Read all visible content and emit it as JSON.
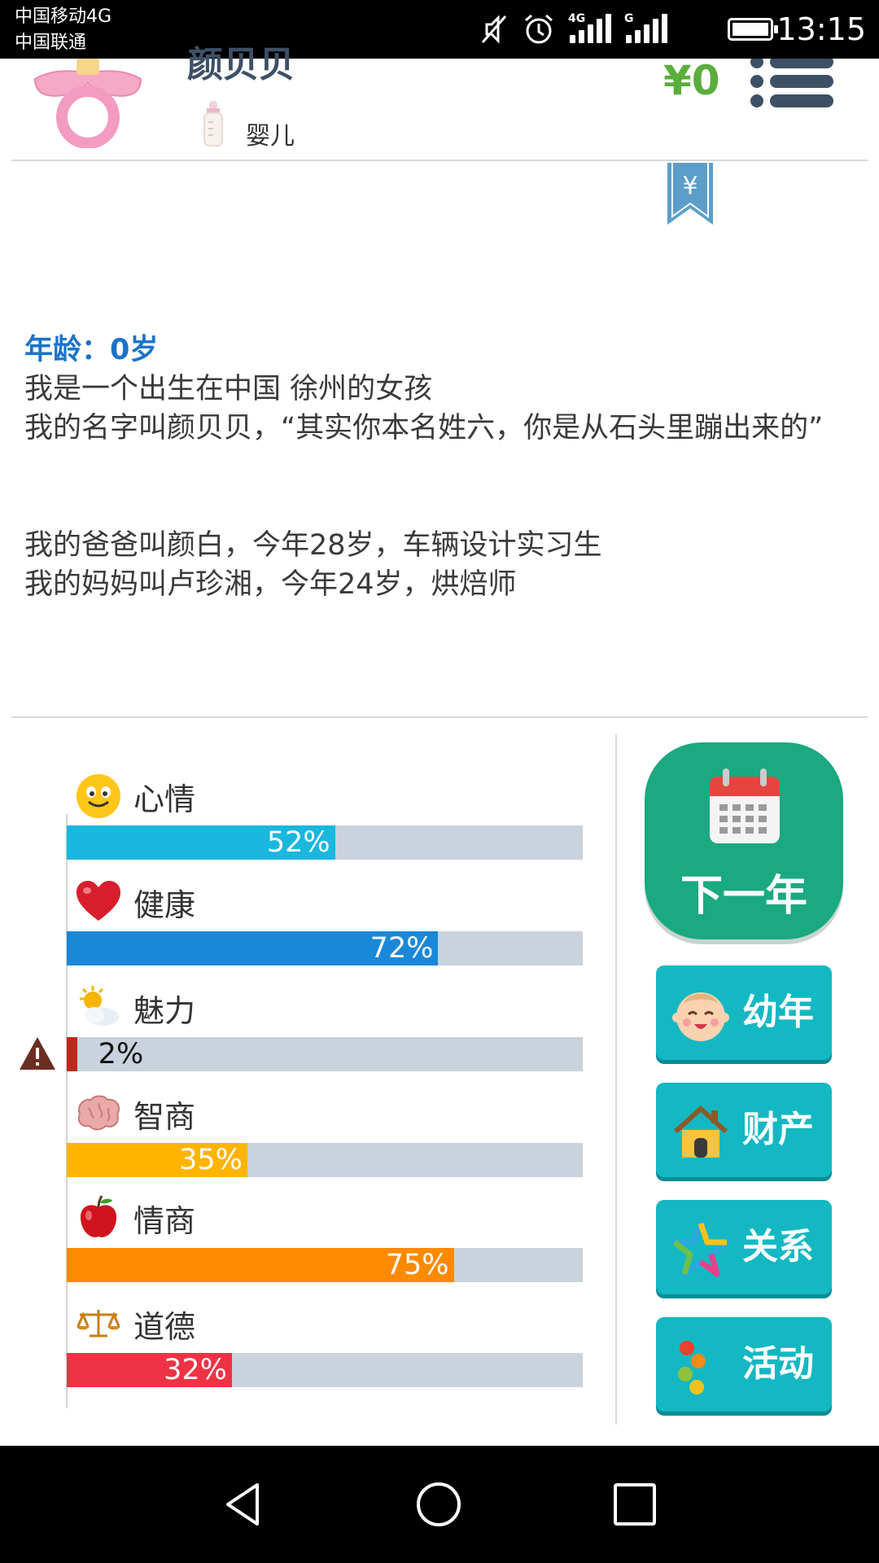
{
  "status_bar": {
    "carrier1": "中国移动4G",
    "carrier2": "中国联通",
    "sig1_tag": "4G",
    "sig2_tag": "G",
    "time": "13:15"
  },
  "header": {
    "name": "颜贝贝",
    "stage": "婴儿",
    "money": "¥0"
  },
  "story": {
    "age": "年龄：0岁",
    "line1": "我是一个出生在中国 徐州的女孩",
    "line2": "我的名字叫颜贝贝，“其实你本名姓六，你是从石头里蹦出来的”",
    "line3": "我的爸爸叫颜白，今年28岁，车辆设计实习生",
    "line4": "我的妈妈叫卢珍湘，今年24岁，烘焙师"
  },
  "stats": [
    {
      "label": "心情",
      "value": 52,
      "display": "52%",
      "color": "#1ab7de",
      "icon": "smiley-icon"
    },
    {
      "label": "健康",
      "value": 72,
      "display": "72%",
      "color": "#1a88d8",
      "icon": "heart-icon"
    },
    {
      "label": "魅力",
      "value": 2,
      "display": "2%",
      "color": "#c0281c",
      "icon": "sun-cloud-icon"
    },
    {
      "label": "智商",
      "value": 35,
      "display": "35%",
      "color": "#ffb400",
      "icon": "brain-icon"
    },
    {
      "label": "情商",
      "value": 75,
      "display": "75%",
      "color": "#ff8a00",
      "icon": "apple-icon"
    },
    {
      "label": "道德",
      "value": 32,
      "display": "32%",
      "color": "#ee3344",
      "icon": "scales-icon"
    }
  ],
  "actions": {
    "next_year": "下一年",
    "childhood": "幼年",
    "property": "财产",
    "relations": "关系",
    "activities": "活动"
  },
  "colors": {
    "money": "#5aae3c",
    "age": "#1a73c9",
    "next_button": "#1aa980",
    "side_button": "#14b8c2",
    "bar_track": "#c9d2dd"
  }
}
